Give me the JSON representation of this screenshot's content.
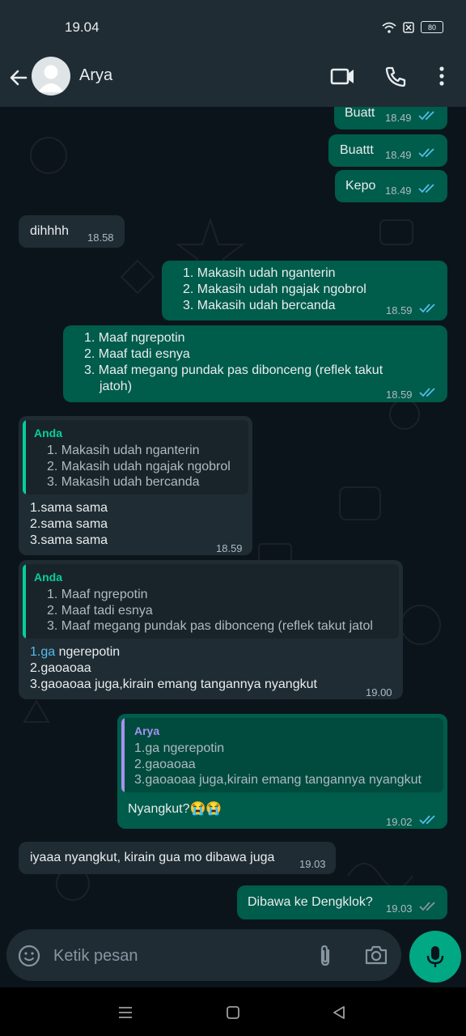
{
  "status_bar": {
    "time": "19.04",
    "battery": "80"
  },
  "header": {
    "contact_name": "Arya"
  },
  "messages": [
    {
      "text": "Buatt",
      "time": "18.49"
    },
    {
      "text": "Buattt",
      "time": "18.49"
    },
    {
      "text": "Kepo",
      "time": "18.49"
    },
    {
      "text": "dihhhh",
      "time": "18.58"
    },
    {
      "lines": [
        "Makasih udah nganterin",
        "Makasih udah ngajak ngobrol",
        "Makasih udah bercanda"
      ],
      "time": "18.59"
    },
    {
      "lines": [
        "Maaf ngrepotin",
        "Maaf tadi esnya",
        "Maaf megang pundak pas dibonceng (reflek takut",
        "jatoh)"
      ],
      "time": "18.59"
    },
    {
      "quote_author": "Anda",
      "quote_lines": [
        "1. Makasih udah nganterin",
        "2. Makasih udah ngajak ngobrol",
        "3. Makasih udah bercanda"
      ],
      "lines": [
        "1.sama sama",
        "2.sama sama",
        "3.sama sama"
      ],
      "time": "18.59"
    },
    {
      "quote_author": "Anda",
      "quote_lines": [
        "1. Maaf ngrepotin",
        "2. Maaf tadi esnya",
        "3. Maaf megang pundak pas dibonceng (reflek takut jatol"
      ],
      "line1_link": "1.ga",
      "line1_rest": " ngerepotin",
      "lines": [
        "2.gaoaoaa",
        "3.gaoaoaa juga,kirain emang tangannya nyangkut"
      ],
      "time": "19.00"
    },
    {
      "quote_author": "Arya",
      "quote_lines": [
        "1.ga ngerepotin",
        "2.gaoaoaa",
        "3.gaoaoaa juga,kirain emang tangannya nyangkut"
      ],
      "text": "Nyangkut?😭😭",
      "time": "19.02"
    },
    {
      "text": "iyaaa nyangkut, kirain gua mo dibawa juga",
      "time": "19.03"
    },
    {
      "text": "Dibawa ke Dengklok?",
      "time": "19.03"
    }
  ],
  "input": {
    "placeholder": "Ketik pesan"
  },
  "colors": {
    "outgoing_bubble": "#005c4b",
    "incoming_bubble": "#1f2c34",
    "accent": "#00a884",
    "read_tick": "#53bdeb",
    "quote_anda": "#06cf9c",
    "quote_arya": "#a791f3",
    "link": "#53bdeb"
  },
  "icons": [
    "back-arrow-icon",
    "avatar-icon",
    "video-call-icon",
    "phone-icon",
    "more-options-icon",
    "double-check-icon",
    "emoji-icon",
    "attach-icon",
    "camera-icon",
    "mic-icon"
  ]
}
